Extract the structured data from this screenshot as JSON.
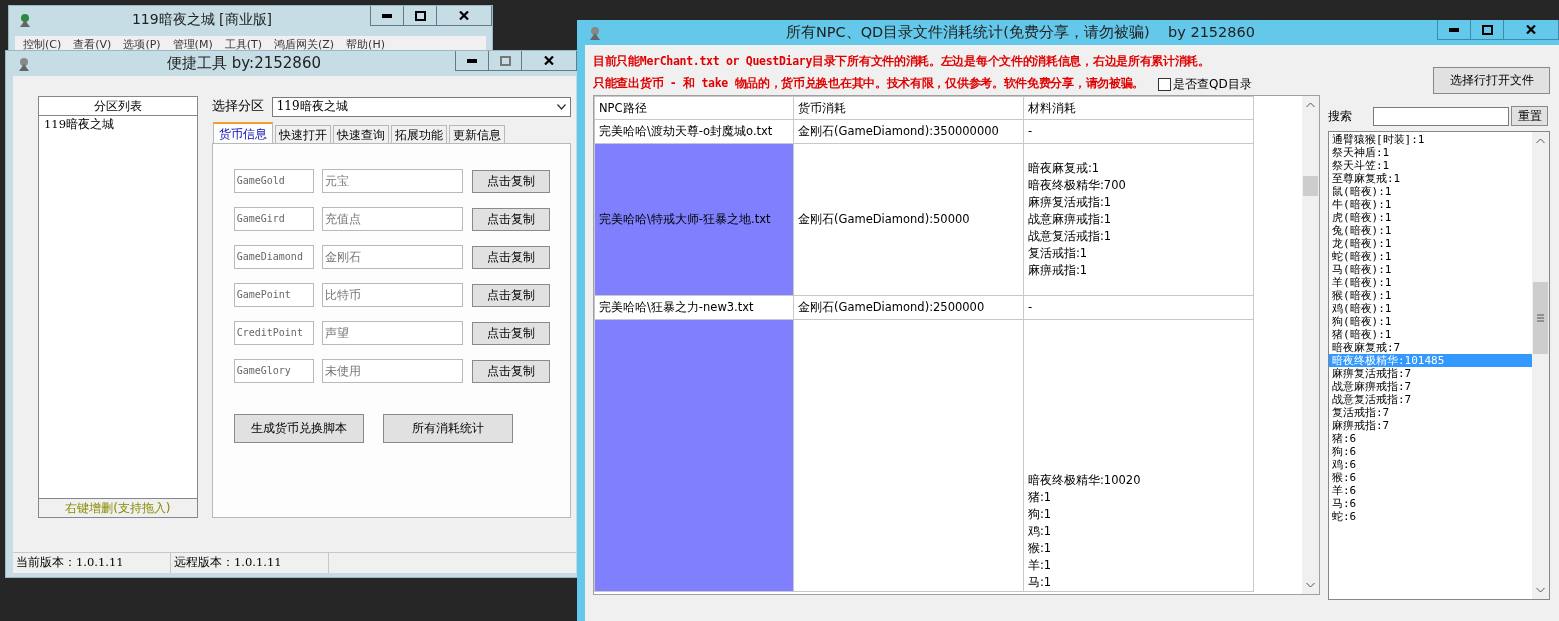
{
  "main_window": {
    "title": "119暗夜之城 [商业版]",
    "menu": [
      "控制(C)",
      "查看(V)",
      "选项(P)",
      "管理(M)",
      "工具(T)",
      "鸿盾网关(Z)",
      "帮助(H)"
    ]
  },
  "tool_window": {
    "title": "便捷工具  by:2152860",
    "partition_list": {
      "header": "分区列表",
      "items": [
        {
          "label": "119暗夜之城",
          "selected": false
        }
      ],
      "footer": "右键增删(支持拖入)"
    },
    "select_label": "选择分区",
    "select_value": "119暗夜之城",
    "tabs": [
      {
        "label": "货币信息",
        "selected": true
      },
      {
        "label": "快速打开",
        "selected": false
      },
      {
        "label": "快速查询",
        "selected": false
      },
      {
        "label": "拓展功能",
        "selected": false
      },
      {
        "label": "更新信息",
        "selected": false
      }
    ],
    "currency_rows": [
      {
        "code": "GameGold",
        "name": "元宝",
        "button": "点击复制"
      },
      {
        "code": "GameGird",
        "name": "充值点",
        "button": "点击复制"
      },
      {
        "code": "GameDiamond",
        "name": "金刚石",
        "button": "点击复制"
      },
      {
        "code": "GamePoint",
        "name": "比特币",
        "button": "点击复制"
      },
      {
        "code": "CreditPoint",
        "name": "声望",
        "button": "点击复制"
      },
      {
        "code": "GameGlory",
        "name": "未使用",
        "button": "点击复制"
      }
    ],
    "actions": [
      "生成货币兑换脚本",
      "所有消耗统计"
    ],
    "status_bar": [
      "当前版本：1.0.1.11",
      "远程版本：1.0.1.11"
    ]
  },
  "stats_window": {
    "title": "所有NPC、QD目录文件消耗统计(免费分享，请勿被骗)    by 2152860",
    "notes": [
      "目前只能MerChant.txt or QuestDiary目录下所有文件的消耗。左边是每个文件的消耗信息，右边是所有累计消耗。",
      "只能查出货币 - 和 take 物品的，货币兑换也在其中。技术有限，仅供参考。软件免费分享，请勿被骗。"
    ],
    "qd_checkbox": {
      "label": "是否查QD目录",
      "checked": false
    },
    "open_button": "选择行打开文件",
    "search_label": "搜索",
    "reset_button": "重置",
    "table": {
      "columns": [
        "NPC路径",
        "货币消耗",
        "材料消耗"
      ],
      "rows": [
        {
          "path": "完美哈哈\\渡劫天尊-o封魔城o.txt",
          "currency": "金刚石(GameDiamond):350000000",
          "materials": [
            "-"
          ],
          "highlighted": false
        },
        {
          "path": "完美哈哈\\特戒大师-狂暴之地.txt",
          "currency": "金刚石(GameDiamond):50000",
          "materials": [
            "暗夜麻复戒:1",
            "暗夜终极精华:700",
            "麻痹复活戒指:1",
            "战意麻痹戒指:1",
            "战意复活戒指:1",
            "复活戒指:1",
            "麻痹戒指:1"
          ],
          "highlighted": true
        },
        {
          "path": "完美哈哈\\狂暴之力-new3.txt",
          "currency": "金刚石(GameDiamond):2500000",
          "materials": [
            "-"
          ],
          "highlighted": false
        },
        {
          "materials": [
            "暗夜终极精华:10020",
            "猪:1",
            "狗:1",
            "鸡:1",
            "猴:1",
            "羊:1",
            "马:1"
          ],
          "highlighted": true
        }
      ]
    },
    "totals": [
      {
        "label": "通臂猿猴[时装]:1",
        "selected": false
      },
      {
        "label": "祭天神盾:1",
        "selected": false
      },
      {
        "label": "祭天斗笠:1",
        "selected": false
      },
      {
        "label": "至尊麻复戒:1",
        "selected": false
      },
      {
        "label": "鼠(暗夜):1",
        "selected": false
      },
      {
        "label": "牛(暗夜):1",
        "selected": false
      },
      {
        "label": "虎(暗夜):1",
        "selected": false
      },
      {
        "label": "兔(暗夜):1",
        "selected": false
      },
      {
        "label": "龙(暗夜):1",
        "selected": false
      },
      {
        "label": "蛇(暗夜):1",
        "selected": false
      },
      {
        "label": "马(暗夜):1",
        "selected": false
      },
      {
        "label": "羊(暗夜):1",
        "selected": false
      },
      {
        "label": "猴(暗夜):1",
        "selected": false
      },
      {
        "label": "鸡(暗夜):1",
        "selected": false
      },
      {
        "label": "狗(暗夜):1",
        "selected": false
      },
      {
        "label": "猪(暗夜):1",
        "selected": false
      },
      {
        "label": "暗夜麻复戒:7",
        "selected": false
      },
      {
        "label": "暗夜终极精华:101485",
        "selected": true
      },
      {
        "label": "麻痹复活戒指:7",
        "selected": false
      },
      {
        "label": "战意麻痹戒指:7",
        "selected": false
      },
      {
        "label": "战意复活戒指:7",
        "selected": false
      },
      {
        "label": "复活戒指:7",
        "selected": false
      },
      {
        "label": "麻痹戒指:7",
        "selected": false
      },
      {
        "label": "猪:6",
        "selected": false
      },
      {
        "label": "狗:6",
        "selected": false
      },
      {
        "label": "鸡:6",
        "selected": false
      },
      {
        "label": "猴:6",
        "selected": false
      },
      {
        "label": "羊:6",
        "selected": false
      },
      {
        "label": "马:6",
        "selected": false
      },
      {
        "label": "蛇:6",
        "selected": false
      }
    ]
  }
}
